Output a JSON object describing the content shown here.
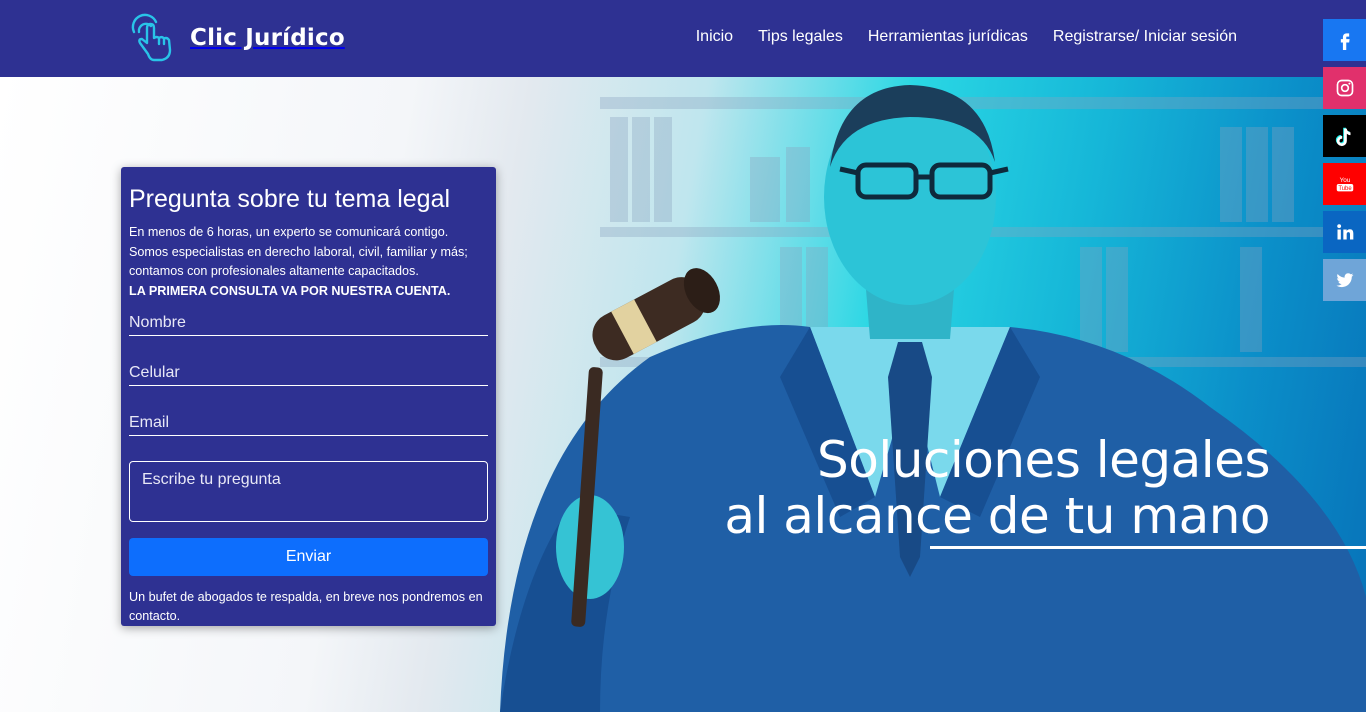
{
  "brand": {
    "name": "Clic Jurídico",
    "icon": "hand-click-icon"
  },
  "nav": [
    "Inicio",
    "Tips legales",
    "Herramientas jurídicas",
    "Registrarse/ Iniciar sesión"
  ],
  "social": [
    {
      "name": "facebook-icon",
      "glyph": "f",
      "color": "#1877f2"
    },
    {
      "name": "instagram-icon",
      "glyph": "◎",
      "color": "#e1306c"
    },
    {
      "name": "tiktok-icon",
      "glyph": "♪",
      "color": "#000000"
    },
    {
      "name": "youtube-icon",
      "glyph": "You Tube",
      "color": "#ff0000"
    },
    {
      "name": "linkedin-icon",
      "glyph": "in",
      "color": "#0a66c2"
    },
    {
      "name": "twitter-icon",
      "glyph": "🐦",
      "color": "#6fa5d8"
    }
  ],
  "form": {
    "title": "Pregunta sobre tu tema legal",
    "desc1": "En menos de 6 horas, un experto se comunicará contigo.",
    "desc2": "Somos especialistas en derecho laboral, civil, familiar y más;",
    "desc3": "contamos con profesionales altamente capacitados.",
    "promo": "LA PRIMERA CONSULTA VA POR NUESTRA CUENTA.",
    "name_placeholder": "Nombre",
    "phone_placeholder": "Celular",
    "email_placeholder": "Email",
    "question_placeholder": "Escribe tu pregunta",
    "submit_label": "Enviar",
    "footnote": "Un bufet de abogados te respalda, en breve nos pondremos en contacto."
  },
  "hero": {
    "line1": "Soluciones legales",
    "line2": "al alcance de tu mano"
  },
  "colors": {
    "primary": "#2e3192",
    "button": "#0d6efd",
    "hero_accent": "#16b7d8"
  }
}
